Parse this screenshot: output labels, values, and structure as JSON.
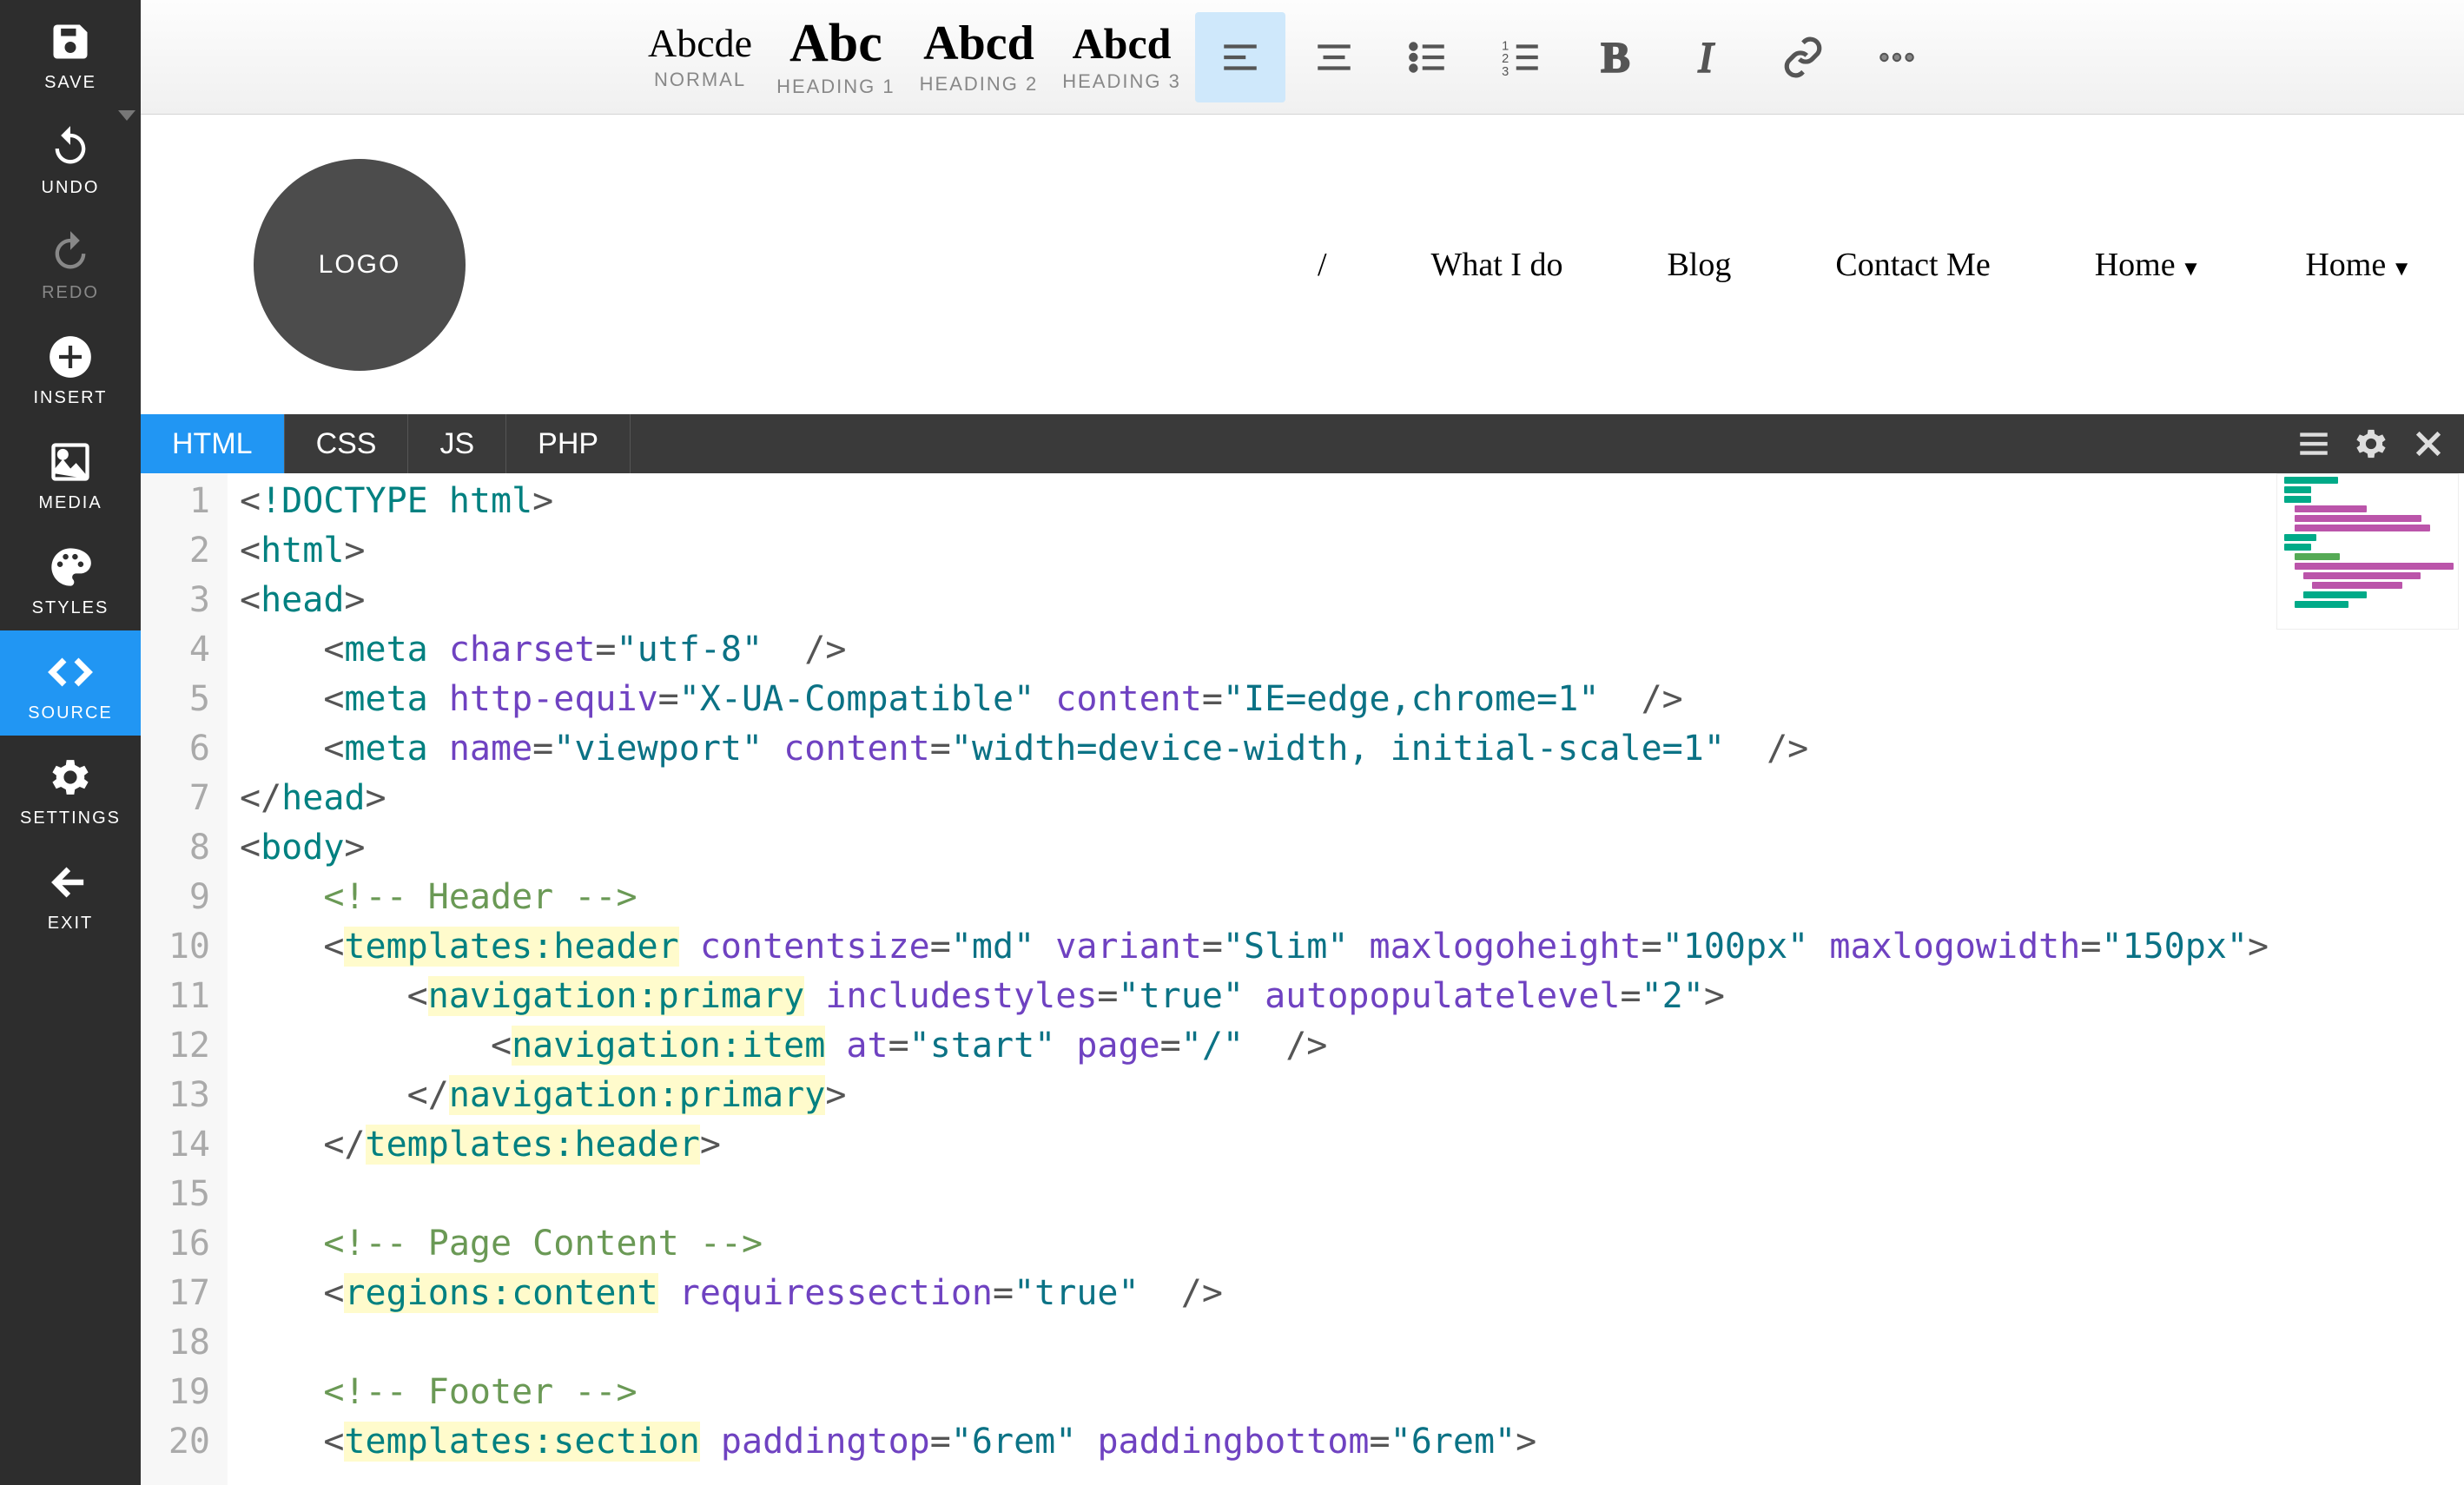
{
  "sidebar": {
    "save": "SAVE",
    "undo": "UNDO",
    "redo": "REDO",
    "insert": "INSERT",
    "media": "MEDIA",
    "styles": "STYLES",
    "source": "SOURCE",
    "settings": "SETTINGS",
    "exit": "EXIT"
  },
  "toolbar": {
    "normal_sample": "Abcde",
    "normal_label": "NORMAL",
    "h1_sample": "Abc",
    "h1_label": "HEADING 1",
    "h2_sample": "Abcd",
    "h2_label": "HEADING 2",
    "h3_sample": "Abcd",
    "h3_label": "HEADING 3"
  },
  "preview": {
    "logo": "LOGO",
    "nav": [
      "/",
      "What I do",
      "Blog",
      "Contact Me",
      "Home",
      "Home"
    ]
  },
  "code_tabs": [
    "HTML",
    "CSS",
    "JS",
    "PHP"
  ],
  "code": {
    "lines": [
      {
        "n": "1",
        "raw": "<!DOCTYPE html>"
      },
      {
        "n": "2",
        "raw": "<html>"
      },
      {
        "n": "3",
        "raw": "<head>"
      },
      {
        "n": "4",
        "raw": "    <meta charset=\"utf-8\" />"
      },
      {
        "n": "5",
        "raw": "    <meta http-equiv=\"X-UA-Compatible\" content=\"IE=edge,chrome=1\" />"
      },
      {
        "n": "6",
        "raw": "    <meta name=\"viewport\" content=\"width=device-width, initial-scale=1\" />"
      },
      {
        "n": "7",
        "raw": "</head>"
      },
      {
        "n": "8",
        "raw": "<body>"
      },
      {
        "n": "9",
        "raw": "    <!-- Header -->"
      },
      {
        "n": "10",
        "raw": "    <templates:header contentsize=\"md\" variant=\"Slim\" maxlogoheight=\"100px\" maxlogowidth=\"150px\">"
      },
      {
        "n": "11",
        "raw": "        <navigation:primary includestyles=\"true\" autopopulatelevel=\"2\">"
      },
      {
        "n": "12",
        "raw": "            <navigation:item at=\"start\" page=\"/\" />"
      },
      {
        "n": "13",
        "raw": "        </navigation:primary>"
      },
      {
        "n": "14",
        "raw": "    </templates:header>"
      },
      {
        "n": "15",
        "raw": ""
      },
      {
        "n": "16",
        "raw": "    <!-- Page Content -->"
      },
      {
        "n": "17",
        "raw": "    <regions:content requiressection=\"true\" />"
      },
      {
        "n": "18",
        "raw": ""
      },
      {
        "n": "19",
        "raw": "    <!-- Footer -->"
      },
      {
        "n": "20",
        "raw": "    <templates:section paddingtop=\"6rem\" paddingbottom=\"6rem\">"
      }
    ]
  }
}
